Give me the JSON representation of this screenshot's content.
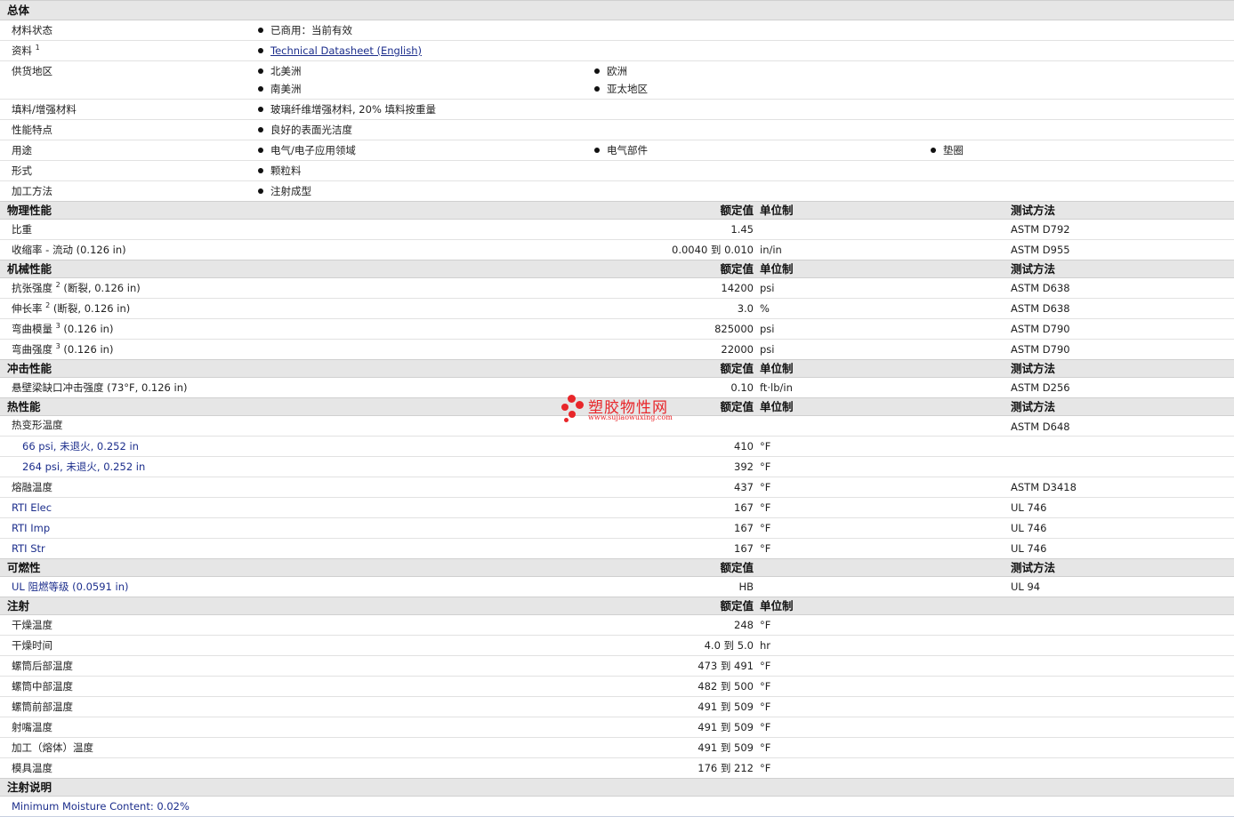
{
  "general": {
    "title": "总体",
    "status_label": "材料状态",
    "status_value": "已商用：当前有效",
    "doc_label": "资料",
    "doc_sup": "1",
    "doc_link": "Technical Datasheet (English)",
    "region_label": "供货地区",
    "regions": [
      "北美洲",
      "欧洲",
      "南美洲",
      "亚太地区"
    ],
    "filler_label": "填料/增强材料",
    "filler_value": "玻璃纤维增强材料, 20% 填料按重量",
    "feature_label": "性能特点",
    "feature_value": "良好的表面光洁度",
    "use_label": "用途",
    "uses": [
      "电气/电子应用领域",
      "电气部件",
      "垫圈"
    ],
    "form_label": "形式",
    "form_value": "颗粒料",
    "process_label": "加工方法",
    "process_value": "注射成型"
  },
  "headers": {
    "value": "额定值",
    "unit": "单位制",
    "method": "测试方法"
  },
  "physical": {
    "title": "物理性能",
    "rows": [
      {
        "label": "比重",
        "value": "1.45",
        "unit": "",
        "method": "ASTM D792"
      },
      {
        "label": "收缩率  - 流动  (0.126 in)",
        "value": "0.0040 到  0.010",
        "unit": "in/in",
        "method": "ASTM D955"
      }
    ]
  },
  "mechanical": {
    "title": "机械性能",
    "rows": [
      {
        "label": "抗张强度",
        "sup": "2",
        "suffix": " (断裂, 0.126 in)",
        "value": "14200",
        "unit": "psi",
        "method": "ASTM D638"
      },
      {
        "label": "伸长率",
        "sup": "2",
        "suffix": " (断裂, 0.126 in)",
        "value": "3.0",
        "unit": "%",
        "method": "ASTM D638"
      },
      {
        "label": "弯曲模量",
        "sup": "3",
        "suffix": " (0.126 in)",
        "value": "825000",
        "unit": "psi",
        "method": "ASTM D790"
      },
      {
        "label": "弯曲强度",
        "sup": "3",
        "suffix": " (0.126 in)",
        "value": "22000",
        "unit": "psi",
        "method": "ASTM D790"
      }
    ]
  },
  "impact": {
    "title": "冲击性能",
    "rows": [
      {
        "label": "悬壁梁缺口冲击强度  (73°F, 0.126 in)",
        "value": "0.10",
        "unit": "ft·lb/in",
        "method": "ASTM D256"
      }
    ]
  },
  "thermal": {
    "title": "热性能",
    "rows": [
      {
        "label": "热变形温度",
        "value": "",
        "unit": "",
        "method": "ASTM D648"
      },
      {
        "label": "66 psi, 未退火, 0.252 in",
        "value": "410",
        "unit": "°F",
        "method": ""
      },
      {
        "label": "264 psi, 未退火, 0.252 in",
        "value": "392",
        "unit": "°F",
        "method": ""
      },
      {
        "label": "熔融温度",
        "value": "437",
        "unit": "°F",
        "method": "ASTM D3418"
      },
      {
        "label": "RTI Elec",
        "value": "167",
        "unit": "°F",
        "method": "UL 746"
      },
      {
        "label": "RTI Imp",
        "value": "167",
        "unit": "°F",
        "method": "UL 746"
      },
      {
        "label": "RTI Str",
        "value": "167",
        "unit": "°F",
        "method": "UL 746"
      }
    ]
  },
  "flammability": {
    "title": "可燃性",
    "rows": [
      {
        "label": "UL 阻燃等级  (0.0591 in)",
        "value": "HB",
        "unit": "",
        "method": "UL 94"
      }
    ]
  },
  "injection": {
    "title": "注射",
    "rows": [
      {
        "label": "干燥温度",
        "value": "248",
        "unit": "°F"
      },
      {
        "label": "干燥时间",
        "value": "4.0 到  5.0",
        "unit": "hr"
      },
      {
        "label": "螺筒后部温度",
        "value": "473 到  491",
        "unit": "°F"
      },
      {
        "label": "螺筒中部温度",
        "value": "482 到  500",
        "unit": "°F"
      },
      {
        "label": "螺筒前部温度",
        "value": "491 到  509",
        "unit": "°F"
      },
      {
        "label": "射嘴温度",
        "value": "491 到  509",
        "unit": "°F"
      },
      {
        "label": "加工（熔体）温度",
        "value": "491 到  509",
        "unit": "°F"
      },
      {
        "label": "模具温度",
        "value": "176 到  212",
        "unit": "°F"
      }
    ]
  },
  "notes": {
    "title": "注射说明",
    "text": "Minimum Moisture Content: 0.02%"
  },
  "watermark": {
    "name": "塑胶物性网",
    "url": "www.sujiaowuxing.com",
    "color": "#e8262a"
  }
}
